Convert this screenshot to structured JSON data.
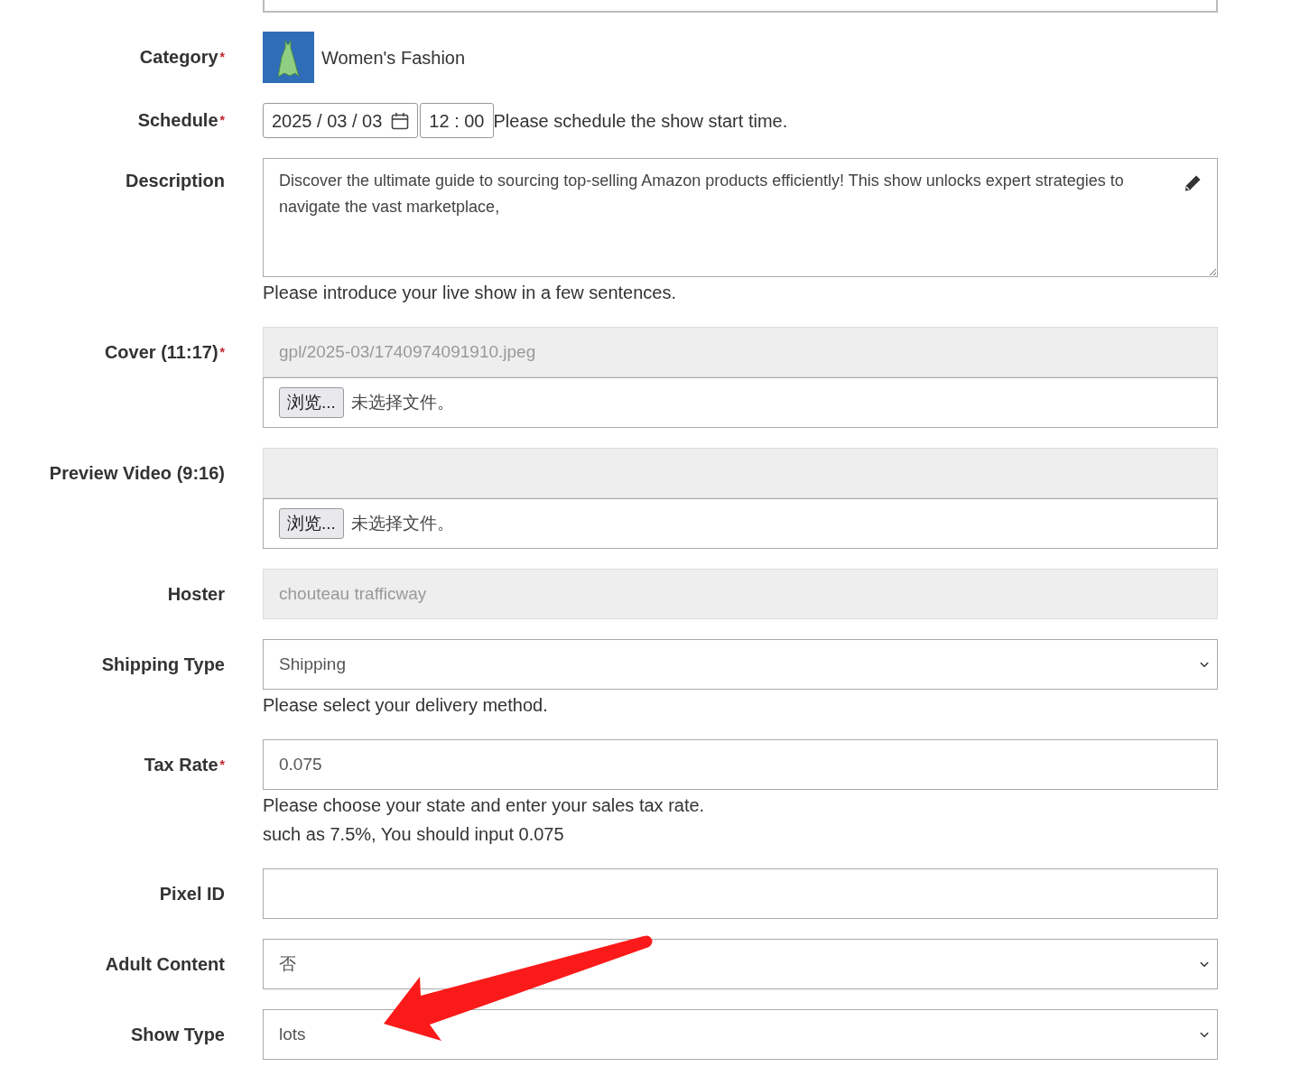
{
  "top_field": {
    "kind": "input"
  },
  "rows": [
    {
      "kind": "category",
      "label": "Category",
      "required_mark": "*",
      "value": "Women's Fashion"
    },
    {
      "kind": "schedule",
      "label": "Schedule",
      "required_mark": "*",
      "date": "2025 / 03 / 03",
      "time": "12 : 00",
      "note": "Please schedule the show start time."
    },
    {
      "kind": "textarea",
      "label": "Description",
      "value": "Discover the ultimate guide to sourcing top-selling Amazon products efficiently! This show unlocks expert strategies to navigate the vast marketplace,",
      "help": [
        "Please introduce your live show in a few sentences."
      ]
    },
    {
      "kind": "upload",
      "label": "Cover (11:17)",
      "required_mark": "*",
      "value": "gpl/2025-03/1740974091910.jpeg",
      "disabled": true,
      "browse": "浏览...",
      "file_status": "未选择文件。"
    },
    {
      "kind": "upload",
      "label": "Preview Video (9:16)",
      "disabled": true,
      "browse": "浏览...",
      "file_status": "未选择文件。"
    },
    {
      "kind": "readonly",
      "label": "Hoster",
      "value": "chouteau trafficway",
      "disabled": true
    },
    {
      "kind": "select",
      "label": "Shipping Type",
      "value": "Shipping",
      "help": [
        "Please select your delivery method."
      ]
    },
    {
      "kind": "input",
      "label": "Tax Rate",
      "required_mark": "*",
      "value": "0.075",
      "help": [
        "Please choose your state and enter your sales tax rate.",
        "such as 7.5%, You should input 0.075"
      ]
    },
    {
      "kind": "input",
      "label": "Pixel ID"
    },
    {
      "kind": "select",
      "label": "Adult Content",
      "value": "否"
    },
    {
      "kind": "select",
      "label": "Show Type",
      "value": "lots"
    }
  ],
  "annotations": [
    {
      "kind": "arrow"
    }
  ]
}
